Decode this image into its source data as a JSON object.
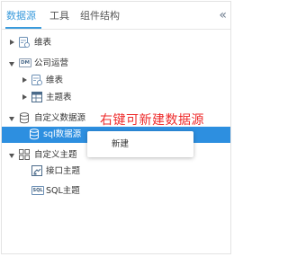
{
  "tabs": [
    {
      "label": "数据源",
      "active": true
    },
    {
      "label": "工具",
      "active": false
    },
    {
      "label": "组件结构",
      "active": false
    }
  ],
  "collapse_glyph": "«",
  "tree": {
    "weibiao_root": "维表",
    "gongsi": {
      "badge": "DM",
      "label": "公司运营"
    },
    "gongsi_weibiao": "维表",
    "gongsi_zhutibiao": "主题表",
    "custom_source": "自定义数据源",
    "sql_source": "sql数据源",
    "custom_topic": "自定义主题",
    "api_topic": "接口主题",
    "sql_topic": {
      "badge": "SQL",
      "label": "SQL主题"
    }
  },
  "annotation": "右键可新建数据源",
  "context_menu": {
    "new_label": "新建"
  },
  "colors": {
    "accent": "#3a9bdc",
    "selected_row": "#2d8fe0",
    "annotation": "#ee2a2a"
  }
}
